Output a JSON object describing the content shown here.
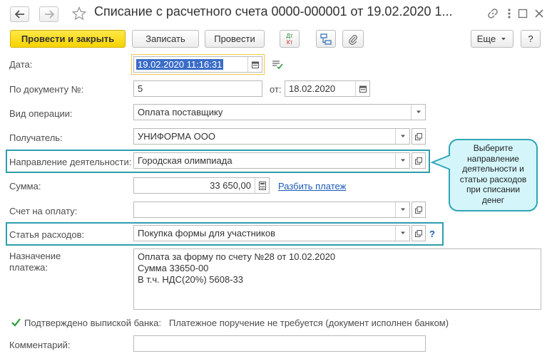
{
  "window": {
    "title": "Списание с расчетного счета 0000-000001 от 19.02.2020 1..."
  },
  "toolbar": {
    "post_and_close": "Провести и закрыть",
    "save": "Записать",
    "post": "Провести",
    "dt_kt_top": "Дт",
    "dt_kt_bottom": "Кт",
    "more": "Еще",
    "help": "?"
  },
  "form": {
    "date": {
      "label": "Дата:",
      "value": "19.02.2020 11:16:31"
    },
    "doc_number": {
      "label": "По документу №:",
      "value": "5",
      "from_label": "от:",
      "from_value": "18.02.2020"
    },
    "operation_type": {
      "label": "Вид операции:",
      "value": "Оплата поставщику"
    },
    "recipient": {
      "label": "Получатель:",
      "value": "УНИФОРМА ООО"
    },
    "activity_direction": {
      "label": "Направление деятельности:",
      "value": "Городская олимпиада"
    },
    "amount": {
      "label": "Сумма:",
      "value": "33 650,00",
      "split_link": "Разбить платеж"
    },
    "invoice": {
      "label": "Счет на оплату:",
      "value": ""
    },
    "expense_item": {
      "label": "Статья расходов:",
      "value": "Покупка формы для участников",
      "help": "?"
    },
    "purpose": {
      "label_line1": "Назначение",
      "label_line2": "платежа:",
      "lines": [
        "Оплата за форму по счету №28 от 10.02.2020",
        "Сумма 33650-00",
        "В т.ч. НДС(20%) 5608-33"
      ]
    },
    "bank_confirmed": {
      "label": "Подтверждено выпиской банка:",
      "checked": true,
      "note": "Платежное поручение не требуется (документ исполнен банком)"
    },
    "comment": {
      "label": "Комментарий:",
      "value": ""
    }
  },
  "callout": {
    "lines": [
      "Выберите",
      "направление",
      "деятельности и",
      "статью расходов",
      "при списании",
      "денег"
    ]
  },
  "colors": {
    "primary_button": "#f7d300",
    "highlight_border": "#2e9eae",
    "callout_fill": "#d4f6fb",
    "link": "#1c5ab8",
    "selection": "#3a6cc8"
  },
  "icons": [
    "back-arrow-icon",
    "forward-arrow-icon",
    "star-icon",
    "link-icon",
    "kebab-menu-icon",
    "maximize-icon",
    "close-icon",
    "dt-kt-icon",
    "structure-icon",
    "paperclip-icon",
    "calendar-icon",
    "dropdown-arrow-icon",
    "open-form-icon",
    "calculator-icon",
    "list-check-icon",
    "checkbox-icon"
  ]
}
